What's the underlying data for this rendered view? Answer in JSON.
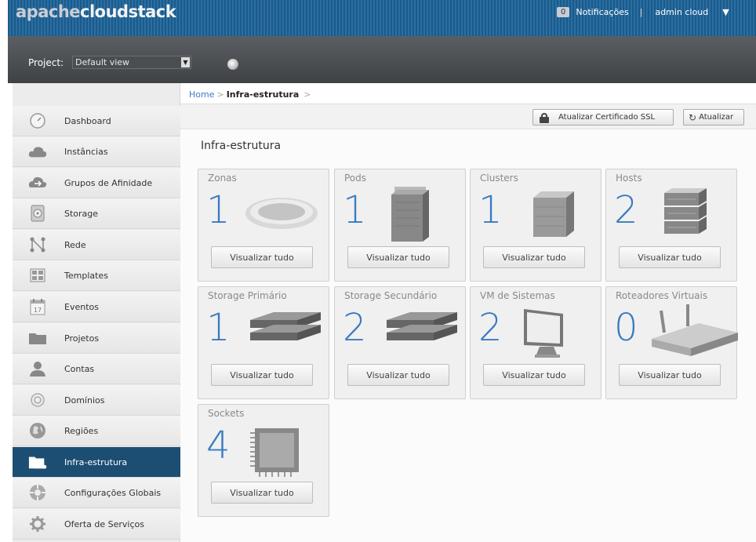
{
  "header": {
    "logo_part1": "apache",
    "logo_part2": "cloudstack",
    "notifications_count": "0",
    "notifications_label": "Notificações",
    "separator": "|",
    "user": "admin cloud",
    "user_caret": "▼"
  },
  "project": {
    "label": "Project:",
    "selected": "Default view"
  },
  "sidebar": {
    "items": [
      {
        "label": "Dashboard",
        "icon": "dashboard-icon"
      },
      {
        "label": "Instâncias",
        "icon": "cloud-icon"
      },
      {
        "label": "Grupos de Afinidade",
        "icon": "affinity-icon"
      },
      {
        "label": "Storage",
        "icon": "storage-icon"
      },
      {
        "label": "Rede",
        "icon": "network-icon"
      },
      {
        "label": "Templates",
        "icon": "templates-icon"
      },
      {
        "label": "Eventos",
        "icon": "calendar-icon"
      },
      {
        "label": "Projetos",
        "icon": "folder-icon"
      },
      {
        "label": "Contas",
        "icon": "user-icon"
      },
      {
        "label": "Domínios",
        "icon": "domain-icon"
      },
      {
        "label": "Regiões",
        "icon": "globe-icon"
      },
      {
        "label": "Infra-estrutura",
        "icon": "infrastructure-icon"
      },
      {
        "label": "Configurações Globais",
        "icon": "global-settings-icon"
      },
      {
        "label": "Oferta de Serviços",
        "icon": "gear-icon"
      }
    ],
    "active_index": 11,
    "calendar_day": "17"
  },
  "breadcrumb": {
    "home": "Home",
    "sep": ">",
    "current": "Infra-estrutura",
    "trailing": ">"
  },
  "toolbar": {
    "ssl_label": "Atualizar Certificado SSL",
    "refresh_label": "Atualizar"
  },
  "main": {
    "title": "Infra-estrutura",
    "view_all_label": "Visualizar tudo",
    "cards": [
      {
        "title": "Zonas",
        "count": "1",
        "icon": "zone-icon"
      },
      {
        "title": "Pods",
        "count": "1",
        "icon": "pod-icon"
      },
      {
        "title": "Clusters",
        "count": "1",
        "icon": "cluster-icon"
      },
      {
        "title": "Hosts",
        "count": "2",
        "icon": "host-icon"
      },
      {
        "title": "Storage Primário",
        "count": "1",
        "icon": "primary-storage-icon"
      },
      {
        "title": "Storage Secundário",
        "count": "2",
        "icon": "secondary-storage-icon"
      },
      {
        "title": "VM de Sistemas",
        "count": "2",
        "icon": "monitor-icon"
      },
      {
        "title": "Roteadores Virtuais",
        "count": "0",
        "icon": "router-icon"
      },
      {
        "title": "Sockets",
        "count": "4",
        "icon": "cpu-icon"
      }
    ]
  }
}
